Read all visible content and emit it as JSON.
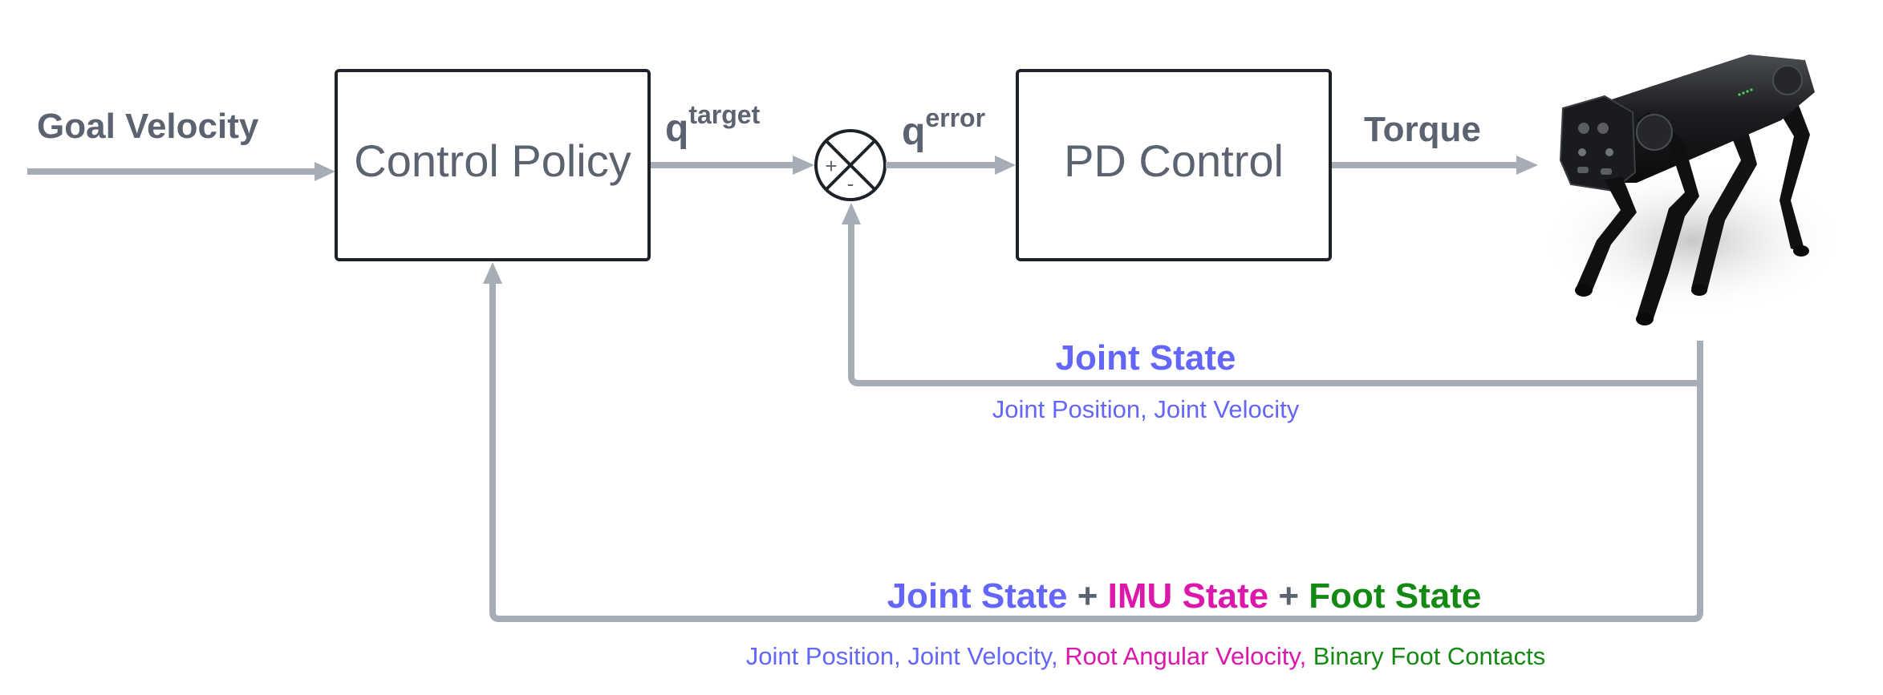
{
  "diagram": {
    "input_label": "Goal Velocity",
    "blocks": {
      "control_policy": "Control Policy",
      "pd_control": "PD Control"
    },
    "signals": {
      "q_target_base": "q",
      "q_target_sup": "target",
      "q_error_base": "q",
      "q_error_sup": "error",
      "torque": "Torque"
    },
    "summing_junction": {
      "plus": "+",
      "minus": "-"
    },
    "robot": {
      "description": "quadruped robot dog"
    },
    "inner_feedback": {
      "title": "Joint State",
      "detail": "Joint Position, Joint Velocity"
    },
    "outer_feedback": {
      "title_parts": [
        {
          "text": "Joint State",
          "category": "joint"
        },
        {
          "text": " + ",
          "category": "operator"
        },
        {
          "text": "IMU State",
          "category": "imu"
        },
        {
          "text": " + ",
          "category": "operator"
        },
        {
          "text": "Foot State",
          "category": "foot"
        }
      ],
      "detail_parts": [
        {
          "text": "Joint Position, Joint Velocity, ",
          "category": "joint"
        },
        {
          "text": "Root Angular Velocity, ",
          "category": "imu"
        },
        {
          "text": "Binary Foot Contacts",
          "category": "foot"
        }
      ]
    },
    "colors": {
      "joint": "#6366f8",
      "imu": "#dc17ab",
      "foot": "#148a14",
      "operator": "#5b6270",
      "text_gray": "#5b6270",
      "arrow_gray": "#a6adb7",
      "box_stroke": "#1d2128"
    }
  }
}
